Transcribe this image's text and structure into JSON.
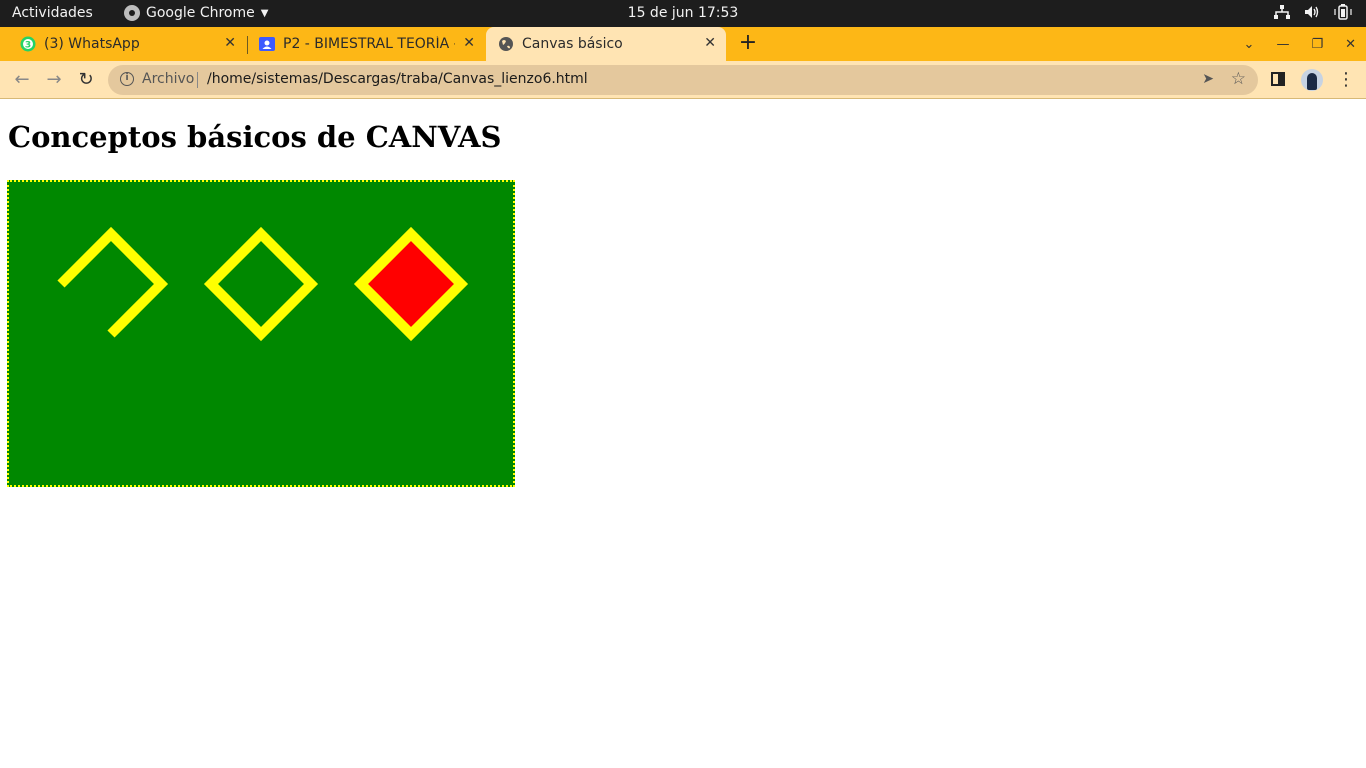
{
  "system_bar": {
    "activities": "Actividades",
    "app_name": "Google Chrome",
    "clock": "15 de jun  17:53"
  },
  "browser": {
    "tabs": [
      {
        "title": "(3) WhatsApp",
        "icon": "whatsapp-icon",
        "badge": "3"
      },
      {
        "title": "P2 - BIMESTRAL TEORÍA - ",
        "icon": "classroom-icon"
      },
      {
        "title": "Canvas básico",
        "icon": "globe-icon",
        "active": true
      }
    ],
    "address": {
      "security_label": "Archivo",
      "url": "/home/sistemas/Descargas/traba/Canvas_lienzo6.html"
    }
  },
  "page": {
    "heading": "Conceptos básicos de CANVAS",
    "canvas": {
      "background": "#008800",
      "border_color": "#ffff00",
      "stroke_color": "#ffff00",
      "fill_color": "#ff0000",
      "shapes": [
        "open-path",
        "stroked-diamond",
        "filled-stroked-diamond"
      ]
    }
  },
  "colors": {
    "top_bar": "#1d1d1d",
    "tab_strip": "#fdb716",
    "active_tab": "#ffe4b3",
    "omnibox": "#e4c89d"
  }
}
